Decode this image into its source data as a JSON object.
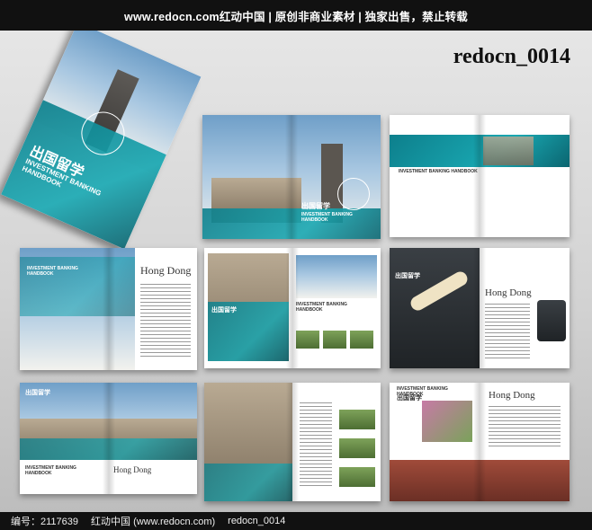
{
  "header": {
    "text": "www.redocn.com红动中国 | 原创非商业素材 | 独家出售，禁止转载"
  },
  "watermark_code": "redocn_0014",
  "brochure": {
    "cn_title": "出国留学",
    "en_title": "INVESTMENT BANKING\nHANDBOOK",
    "en_title_short": "INVESTMENT BANKING HANDBOOK",
    "heading": "Hong Dong"
  },
  "footer": {
    "id": "编号：2117639",
    "site": "红动中国 (www.redocn.com)",
    "code": "redocn_0014"
  }
}
